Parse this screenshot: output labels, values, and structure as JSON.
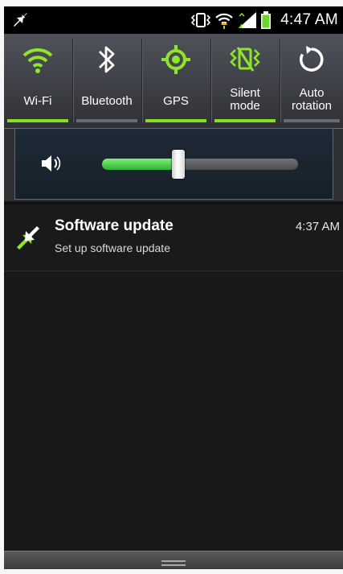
{
  "status_bar": {
    "time": "4:47 AM",
    "icons": [
      "software-update-icon",
      "vibrate-icon",
      "wifi-icon",
      "signal-icon",
      "battery-icon"
    ]
  },
  "quick_settings": {
    "tiles": [
      {
        "label": "Wi-Fi",
        "icon": "wifi-icon",
        "on": true
      },
      {
        "label": "Bluetooth",
        "icon": "bluetooth-icon",
        "on": false
      },
      {
        "label": "GPS",
        "icon": "gps-icon",
        "on": true
      },
      {
        "label": "Silent mode",
        "label_line1": "Silent",
        "label_line2": "mode",
        "icon": "vibrate-icon",
        "on": true
      },
      {
        "label": "Auto rotation",
        "label_line1": "Auto",
        "label_line2": "rotation",
        "icon": "auto-rotation-icon",
        "on": false
      }
    ]
  },
  "volume": {
    "icon": "speaker-icon",
    "level": 0.39
  },
  "notification": {
    "title": "Software update",
    "subtitle": "Set up software update",
    "time": "4:37 AM",
    "icon": "software-update-icon"
  },
  "colors": {
    "accent_on": "#85e022",
    "slider_fill": "#3fc43f"
  }
}
